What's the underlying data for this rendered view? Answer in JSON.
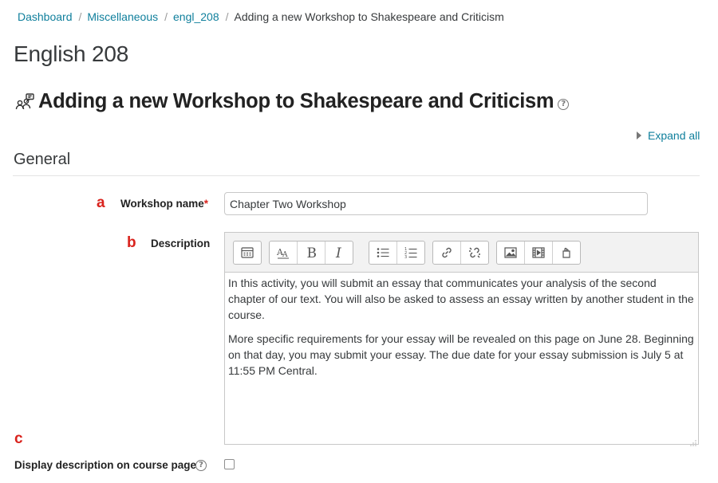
{
  "breadcrumb": {
    "items": [
      "Dashboard",
      "Miscellaneous",
      "engl_208"
    ],
    "current": "Adding a new Workshop to Shakespeare and Criticism",
    "separator": "/"
  },
  "course_title": "English 208",
  "page_heading": {
    "title": "Adding a new Workshop to Shakespeare and Criticism",
    "icon": "workshop-icon",
    "help": "?"
  },
  "expand_all": "Expand all",
  "section": {
    "title": "General"
  },
  "markers": {
    "a": "a",
    "b": "b",
    "c": "c"
  },
  "form": {
    "workshop_name": {
      "label": "Workshop name",
      "required_mark": "*",
      "value": "Chapter Two Workshop"
    },
    "description": {
      "label": "Description",
      "toolbar": [
        "collapse-icon",
        "font-size-icon",
        "bold-icon",
        "italic-icon",
        "bullet-list-icon",
        "numbered-list-icon",
        "link-icon",
        "unlink-icon",
        "image-icon",
        "media-icon",
        "manage-files-icon"
      ],
      "paragraphs": [
        "In this activity, you will submit an essay that communicates your analysis of the second chapter of our text.  You will also be asked to assess an essay written by another student in the course.",
        "More specific requirements for your essay will be revealed on this page on June 28.  Beginning on that day, you may submit your essay.  The due date for your essay submission is July 5 at 11:55 PM Central."
      ]
    },
    "display_description": {
      "label": "Display description on course page",
      "help": "?",
      "checked": false
    }
  },
  "colors": {
    "link": "#0f7f9c",
    "required": "#d9231d",
    "marker": "#d9231d"
  }
}
